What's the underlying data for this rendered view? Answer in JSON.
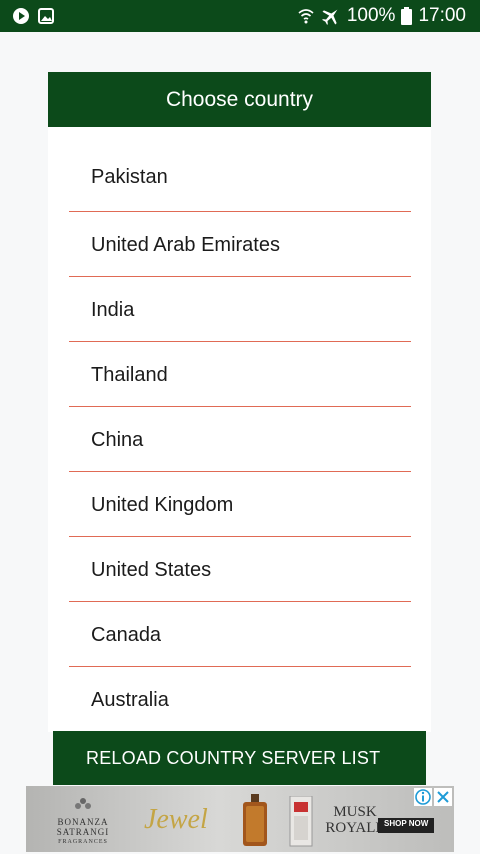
{
  "status_bar": {
    "battery": "100%",
    "time": "17:00",
    "left_icons": [
      "play-icon",
      "image-icon"
    ],
    "right_icons": [
      "wifi-icon",
      "airplane-icon",
      "battery-icon"
    ]
  },
  "dialog": {
    "title": "Choose country",
    "countries": [
      "Pakistan",
      "United Arab Emirates",
      "India",
      "Thailand",
      "China",
      "United Kingdom",
      "United States",
      "Canada",
      "Australia"
    ],
    "reload_label": "RELOAD COUNTRY SERVER LIST"
  },
  "ad": {
    "brand_lines": [
      "BONANZA",
      "SATRANGI",
      "FRAGRANCES"
    ],
    "product_1": "Jewel",
    "product_2_lines": [
      "MUSK",
      "ROYALE"
    ],
    "cta": "SHOP NOW"
  },
  "colors": {
    "primary": "#0c4a1a",
    "divider": "#e06a55",
    "background": "#f7f8f9"
  }
}
